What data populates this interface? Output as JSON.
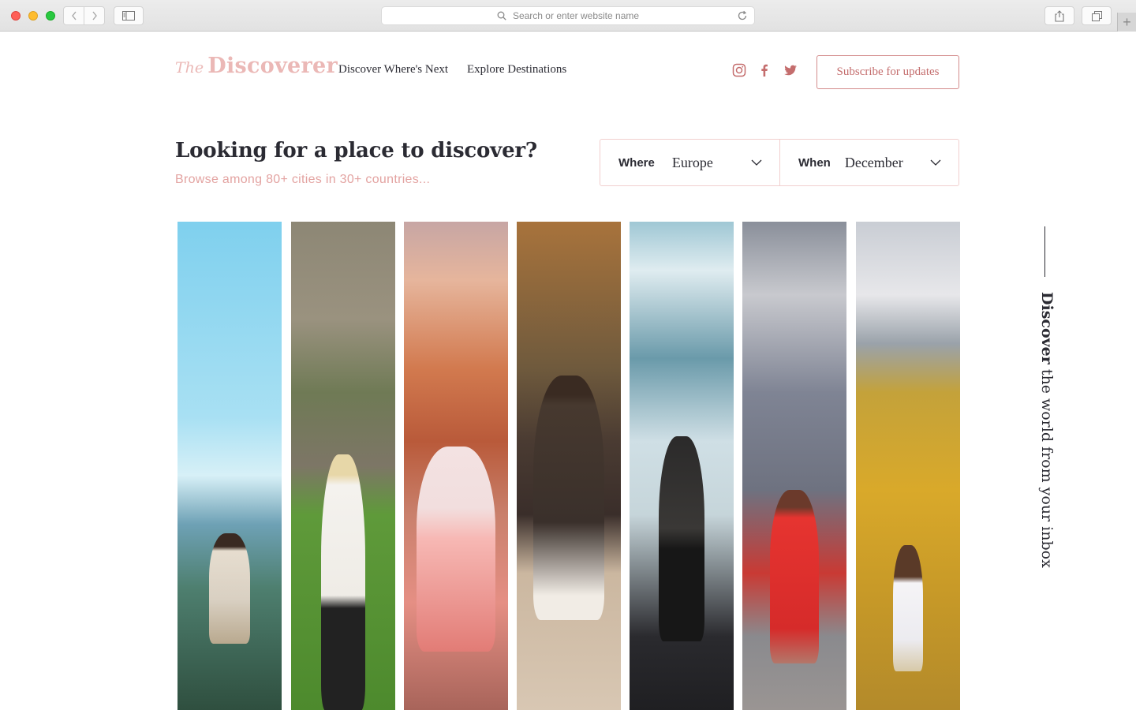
{
  "browser": {
    "address_placeholder": "Search or enter website name"
  },
  "site": {
    "logo_prefix": "The",
    "logo_name": "Discoverer",
    "nav": [
      "Discover Where's Next",
      "Explore Destinations"
    ],
    "social": [
      "instagram-icon",
      "facebook-icon",
      "twitter-icon"
    ],
    "subscribe_label": "Subscribe for updates",
    "accent_color": "#c46d6d"
  },
  "hero": {
    "title": "Looking for a place to discover?",
    "subtitle": "Browse among 80+ cities in 30+ countries..."
  },
  "search": {
    "where_label": "Where",
    "where_value": "Europe",
    "when_label": "When",
    "when_value": "December"
  },
  "side": {
    "strong": "Discover",
    "rest": " the world from your inbox"
  }
}
